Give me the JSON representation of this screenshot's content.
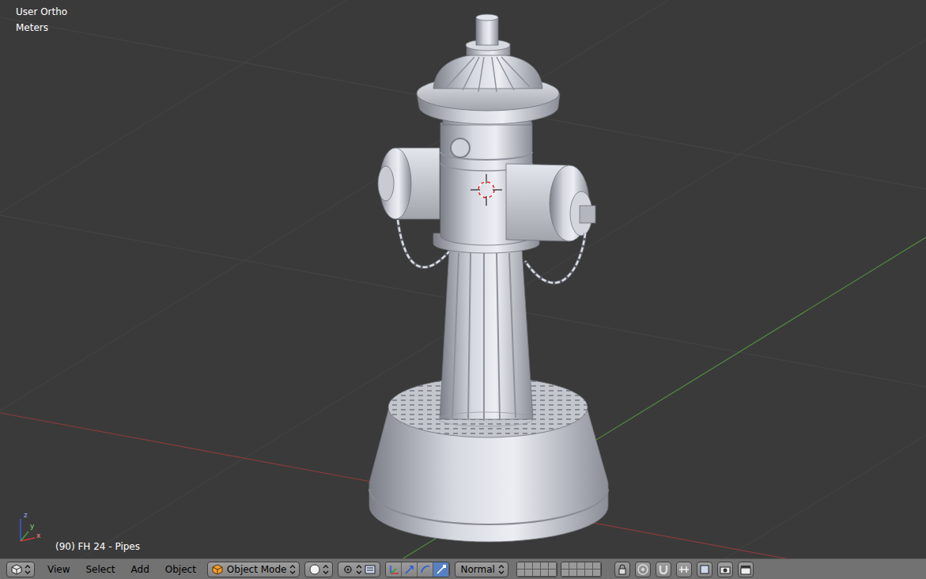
{
  "viewport": {
    "view": "User Ortho",
    "units": "Meters",
    "info": "(90) FH 24 - Pipes",
    "axes": [
      "z",
      "y",
      "x"
    ]
  },
  "header": {
    "menus": [
      "View",
      "Select",
      "Add",
      "Object"
    ],
    "mode": "Object Mode",
    "orientation": "Normal",
    "manipulators": [
      {
        "kind": "toggle",
        "selected": false
      },
      {
        "kind": "translate",
        "selected": false
      },
      {
        "kind": "rotate",
        "selected": false
      },
      {
        "kind": "scale",
        "selected": true
      }
    ]
  }
}
